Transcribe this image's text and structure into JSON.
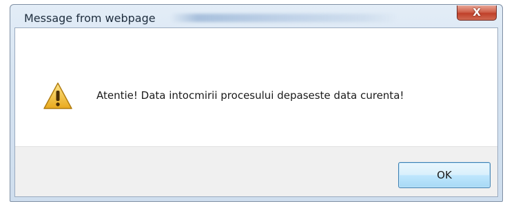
{
  "dialog": {
    "title": "Message from webpage",
    "close_glyph": "X",
    "message": "Atentie! Data intocmirii procesului depaseste data curenta!",
    "icon": "warning-icon",
    "ok_label": "OK"
  },
  "colors": {
    "frame": "#d5e3f1",
    "close_button": "#c7482f",
    "ok_border": "#3c7fb1",
    "warning_fill": "#f5c842"
  }
}
